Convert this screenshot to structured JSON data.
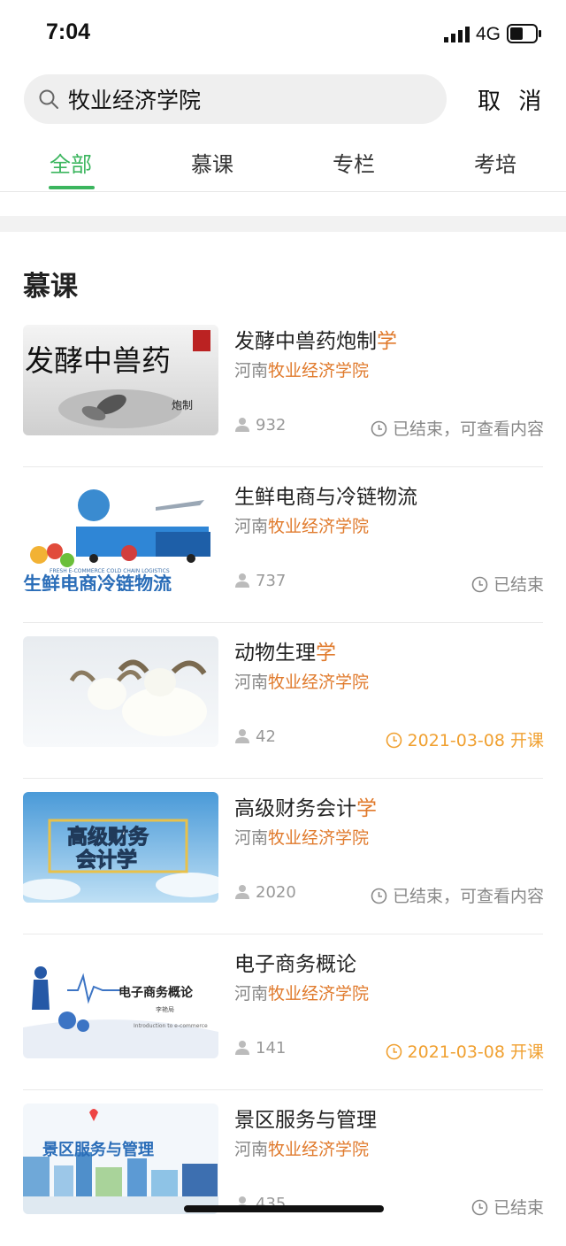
{
  "status_bar": {
    "time": "7:04",
    "network": "4G"
  },
  "search": {
    "value": "牧业经济学院",
    "cancel_label": "取 消"
  },
  "tabs": [
    {
      "label": "全部",
      "active": true
    },
    {
      "label": "慕课",
      "active": false
    },
    {
      "label": "专栏",
      "active": false
    },
    {
      "label": "考培",
      "active": false
    }
  ],
  "section": {
    "title": "慕课"
  },
  "courses": [
    {
      "title_main": "发酵中兽药炮制",
      "title_highlight": "学",
      "org_prefix": "河南",
      "org_highlight": "牧业经济学院",
      "count": "932",
      "status": "已结束，可查看内容",
      "status_color": "gray"
    },
    {
      "title_main": "生鲜电商与冷链物流",
      "title_highlight": "",
      "org_prefix": "河南",
      "org_highlight": "牧业经济学院",
      "count": "737",
      "status": "已结束",
      "status_color": "gray"
    },
    {
      "title_main": "动物生理",
      "title_highlight": "学",
      "org_prefix": "河南",
      "org_highlight": "牧业经济学院",
      "count": "42",
      "status": "2021-03-08 开课",
      "status_color": "orange"
    },
    {
      "title_main": "高级财务会计",
      "title_highlight": "学",
      "org_prefix": "河南",
      "org_highlight": "牧业经济学院",
      "count": "2020",
      "status": "已结束，可查看内容",
      "status_color": "gray"
    },
    {
      "title_main": "电子商务概论",
      "title_highlight": "",
      "org_prefix": "河南",
      "org_highlight": "牧业经济学院",
      "count": "141",
      "status": "2021-03-08 开课",
      "status_color": "orange"
    },
    {
      "title_main": "景区服务与管理",
      "title_highlight": "",
      "org_prefix": "河南",
      "org_highlight": "牧业经济学院",
      "count": "435",
      "status": "已结束",
      "status_color": "gray"
    }
  ],
  "thumb_text": {
    "t0_big": "发酵中兽药",
    "t0_small": "炮制",
    "t1_en": "FRESH E-COMMERCE COLD CHAIN LOGISTICS",
    "t1_cn": "生鲜电商冷链物流",
    "t3_line1": "高级财务",
    "t3_line2": "会计学",
    "t4_cn": "电子商务概论",
    "t4_author": "李艳局",
    "t4_en": "Introduction to e-commerce",
    "t5_cn": "景区服务与管理"
  },
  "colors": {
    "accent": "#3bb55e",
    "highlight": "#e07a2c",
    "status_orange": "#f0a030"
  }
}
